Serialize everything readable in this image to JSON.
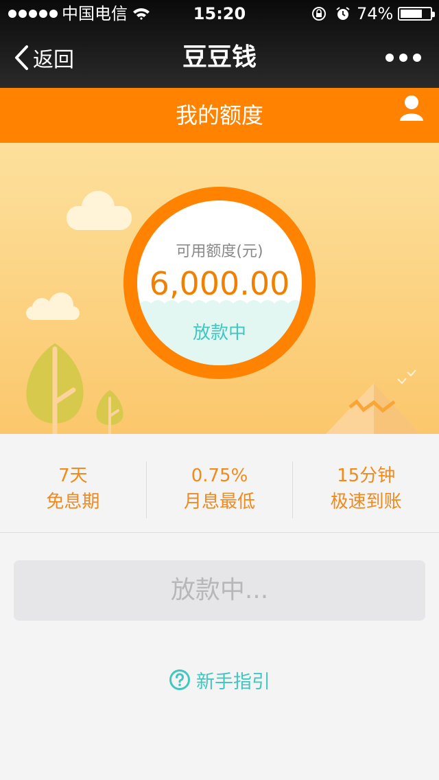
{
  "status_bar": {
    "carrier": "中国电信",
    "time": "15:20",
    "battery_percent": "74%",
    "battery_level": 0.74,
    "signal_dots": 5
  },
  "nav": {
    "back_label": "返回",
    "title": "豆豆钱"
  },
  "header": {
    "title": "我的额度"
  },
  "quota": {
    "label": "可用额度(元)",
    "amount": "6,000.00",
    "status": "放款中"
  },
  "features": [
    {
      "value": "7天",
      "desc": "免息期"
    },
    {
      "value": "0.75%",
      "desc": "月息最低"
    },
    {
      "value": "15分钟",
      "desc": "极速到账"
    }
  ],
  "action_button": {
    "label": "放款中..."
  },
  "guide": {
    "label": "新手指引"
  },
  "colors": {
    "accent": "#ff8200",
    "teal": "#41c6c0"
  },
  "icons": [
    "wifi-icon",
    "rotation-lock-icon",
    "alarm-icon",
    "battery-icon",
    "chevron-left-icon",
    "more-icon",
    "user-icon",
    "help-icon"
  ]
}
